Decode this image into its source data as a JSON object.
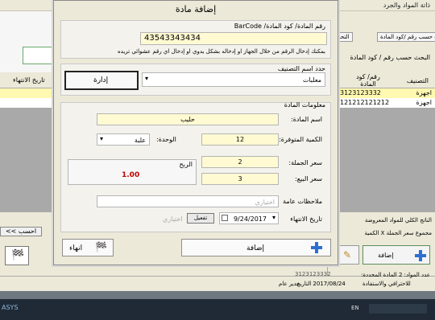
{
  "background": {
    "title": "ذاتة المواد والجرد",
    "tabs": [
      "البحث حسب رقم /كود المادة",
      "التحب"
    ],
    "search_label": "البحث حسب رقم / كود المادة",
    "grid": {
      "headers": [
        "التصنيف",
        "رقم/ كود المادة",
        "تاريخ الانتهاء"
      ],
      "rows": [
        {
          "category": "اجهزة",
          "code": "3123123332"
        },
        {
          "category": "اجهزة",
          "code": "121212121212"
        }
      ]
    },
    "prev_button": "<< احسب",
    "total_label": "الناتج الكلي للمواد المعروضة",
    "total_sub": "مجموع سعر الجملة X الكمية",
    "add_button": "إضافة",
    "status": {
      "shown_count": "عدد المواد: 2  المادة المحددة:",
      "selected_code": "3123123332",
      "date_label": "2017/08/24 التاريخ",
      "user_label": "مدير عام",
      "slogan": "للاحترافي والاستفادة"
    }
  },
  "dialog": {
    "title": "إضافة مادة",
    "barcode_label": "رقم المادة/ كود المادة/ BarCode",
    "barcode_value": "43543343434",
    "barcode_hint": "بمكنك إدخال الرقم من خلال الجهاز او إدخاله بشكل يدوي او إدخال اي رقم عشوائي تريده",
    "category_group": "حدد اسم التصنيف",
    "category_value": "معلبات",
    "management_button": "إدارة",
    "info_group": "معلومات المادة",
    "name_label": "اسم المادة:",
    "name_value": "حليب",
    "quantity_label": "الكمية المتوفرة:",
    "quantity_value": "12",
    "unit_label": "الوحدة:",
    "unit_value": "علبة",
    "wholesale_label": "سعر الجملة:",
    "wholesale_value": "2",
    "sale_label": "سعر البيع:",
    "sale_value": "3",
    "profit_label": "الربح",
    "profit_value": "1.00",
    "notes_label": "ملاحظات عامة",
    "notes_placeholder": "اختياري",
    "expiry_label": "تاريخ الانتهاء",
    "expiry_value": "9/24/2017",
    "expiry_toggle": "تفعيل",
    "optional_label": "اختياري",
    "add_button": "إضافة",
    "close_button": "انهاء"
  },
  "colors": {
    "accent_yellow": "#fffad2",
    "profit_red": "#c00000",
    "plus_blue": "#2d6fd0"
  }
}
